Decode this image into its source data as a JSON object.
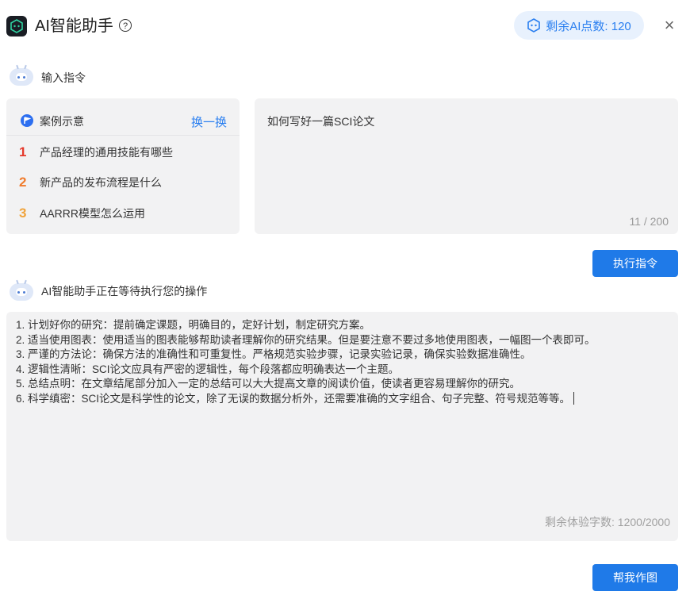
{
  "header": {
    "title": "AI智能助手",
    "help_icon": "?",
    "points_label": "剩余AI点数: 120",
    "close_icon": "×"
  },
  "input_section": {
    "label": "输入指令"
  },
  "examples": {
    "title": "案例示意",
    "swap_label": "换一换",
    "items": [
      {
        "num": "1",
        "text": "产品经理的通用技能有哪些"
      },
      {
        "num": "2",
        "text": "新产品的发布流程是什么"
      },
      {
        "num": "3",
        "text": "AARRR模型怎么运用"
      }
    ]
  },
  "prompt": {
    "value": "如何写好一篇SCI论文",
    "counter": "11 / 200"
  },
  "execute_button": "执行指令",
  "output_section": {
    "label": "AI智能助手正在等待执行您的操作",
    "lines": [
      "1. 计划好你的研究：提前确定课题，明确目的，定好计划，制定研究方案。",
      "2. 适当使用图表：使用适当的图表能够帮助读者理解你的研究结果。但是要注意不要过多地使用图表，一幅图一个表即可。",
      "3. 严谨的方法论：确保方法的准确性和可重复性。严格规范实验步骤，记录实验记录，确保实验数据准确性。",
      "4. 逻辑性清晰：SCI论文应具有严密的逻辑性，每个段落都应明确表达一个主题。",
      "5. 总结点明：在文章结尾部分加入一定的总结可以大大提高文章的阅读价值，使读者更容易理解你的研究。",
      "6. 科学缜密：SCI论文是科学性的论文，除了无误的数据分析外，还需要准确的文字组合、句子完整、符号规范等等。"
    ],
    "remaining": "剩余体验字数: 1200/2000"
  },
  "draw_button": "帮我作图",
  "colors": {
    "accent": "#1f7ae8",
    "panel_bg": "#f2f2f3",
    "badge_bg": "#e8f1fd"
  }
}
